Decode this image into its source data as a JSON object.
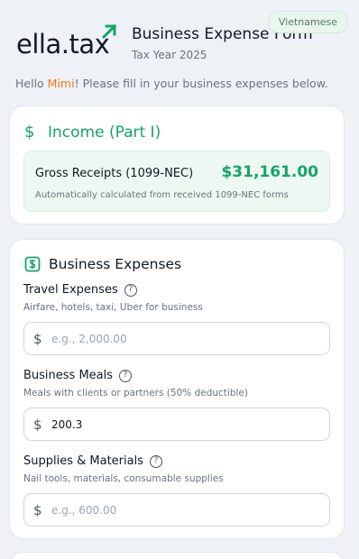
{
  "language": "Vietnamese",
  "brand": {
    "logo_text": "ella.tax"
  },
  "header": {
    "title": "Business Expense Form",
    "subtitle": "Tax Year 2025"
  },
  "greeting": {
    "prefix": "Hello ",
    "name": "Mimi",
    "suffix": "! Please fill in your business expenses below."
  },
  "income": {
    "currency_symbol": "$",
    "title": "Income (Part I)",
    "gross_receipts_label": "Gross Receipts (1099-NEC)",
    "gross_receipts_value": "$31,161.00",
    "note": "Automatically calculated from received 1099-NEC forms"
  },
  "expenses": {
    "title": "Business Expenses",
    "currency_symbol": "$",
    "fields": [
      {
        "label": "Travel Expenses",
        "help": "?",
        "description": "Airfare, hotels, taxi, Uber for business",
        "value": "",
        "placeholder": "e.g., 2,000.00"
      },
      {
        "label": "Business Meals",
        "help": "?",
        "description": "Meals with clients or partners (50% deductible)",
        "value": "200.3",
        "placeholder": ""
      },
      {
        "label": "Supplies & Materials",
        "help": "?",
        "description": "Nail tools, materials, consumable supplies",
        "value": "",
        "placeholder": "e.g., 600.00"
      }
    ]
  },
  "colors": {
    "accent": "#16a36a",
    "name_highlight": "#f97316",
    "background": "#eef1f5"
  }
}
